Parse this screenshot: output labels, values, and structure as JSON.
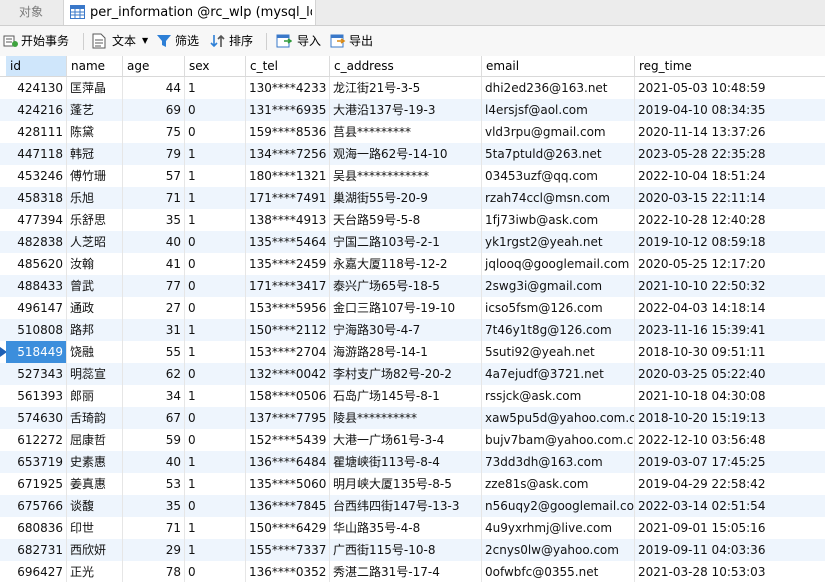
{
  "tabs": {
    "objects": "对象",
    "active": "per_information @rc_wlp (mysql_loc..."
  },
  "toolbar": {
    "begin_tx": "开始事务",
    "text": "文本",
    "filter": "筛选",
    "sort": "排序",
    "import": "导入",
    "export": "导出"
  },
  "columns": [
    "id",
    "name",
    "age",
    "sex",
    "c_tel",
    "c_address",
    "email",
    "reg_time"
  ],
  "rows": [
    [
      "424130",
      "匡萍晶",
      "44",
      "1",
      "130****4233",
      "龙江街21号-3-5",
      "dhi2ed236@163.net",
      "2021-05-03 10:48:59"
    ],
    [
      "424216",
      "蓬艺",
      "69",
      "0",
      "131****6935",
      "大港沿137号-19-3",
      "l4ersjsf@aol.com",
      "2019-04-10 08:34:35"
    ],
    [
      "428111",
      "陈黛",
      "75",
      "0",
      "159****8536",
      "莒县*********",
      "vld3rpu@gmail.com",
      "2020-11-14 13:37:26"
    ],
    [
      "447118",
      "韩冠",
      "79",
      "1",
      "134****7256",
      "观海一路62号-14-10",
      "5ta7ptuld@263.net",
      "2023-05-28 22:35:28"
    ],
    [
      "453246",
      "傅竹珊",
      "57",
      "1",
      "180****1321",
      "吴县************",
      "03453uzf@qq.com",
      "2022-10-04 18:51:24"
    ],
    [
      "458318",
      "乐旭",
      "71",
      "1",
      "171****7491",
      "巢湖街55号-20-9",
      "rzah74ccl@msn.com",
      "2020-03-15 22:11:14"
    ],
    [
      "477394",
      "乐舒思",
      "35",
      "1",
      "138****4913",
      "天台路59号-5-8",
      "1fj73iwb@ask.com",
      "2022-10-28 12:40:28"
    ],
    [
      "482838",
      "人芝昭",
      "40",
      "0",
      "135****5464",
      "宁国二路103号-2-1",
      "yk1rgst2@yeah.net",
      "2019-10-12 08:59:18"
    ],
    [
      "485620",
      "汝翰",
      "41",
      "0",
      "135****2459",
      "永嘉大厦118号-12-2",
      "jqlooq@googlemail.com",
      "2020-05-25 12:17:20"
    ],
    [
      "488433",
      "曾武",
      "77",
      "0",
      "171****3417",
      "泰兴广场65号-18-5",
      "2swg3i@gmail.com",
      "2021-10-10 22:50:32"
    ],
    [
      "496147",
      "通政",
      "27",
      "0",
      "153****5956",
      "金口三路107号-19-10",
      "icso5fsm@126.com",
      "2022-04-03 14:18:14"
    ],
    [
      "510808",
      "路邦",
      "31",
      "1",
      "150****2112",
      "宁海路30号-4-7",
      "7t46y1t8g@126.com",
      "2023-11-16 15:39:41"
    ],
    [
      "518449",
      "饶融",
      "55",
      "1",
      "153****2704",
      "海游路28号-14-1",
      "5suti92@yeah.net",
      "2018-10-30 09:51:11"
    ],
    [
      "527343",
      "明蕊宣",
      "62",
      "0",
      "132****0042",
      "李村支广场82号-20-2",
      "4a7ejudf@3721.net",
      "2020-03-25 05:22:40"
    ],
    [
      "561393",
      "郎丽",
      "34",
      "1",
      "158****0506",
      "石岛广场145号-8-1",
      "rssjck@ask.com",
      "2021-10-18 04:30:08"
    ],
    [
      "574630",
      "舌琦韵",
      "67",
      "0",
      "137****7795",
      "陵县**********",
      "xaw5pu5d@yahoo.com.cn",
      "2018-10-20 15:19:13"
    ],
    [
      "612272",
      "屈康哲",
      "59",
      "0",
      "152****5439",
      "大港一广场61号-3-4",
      "bujv7bam@yahoo.com.cn",
      "2022-12-10 03:56:48"
    ],
    [
      "653719",
      "史素惠",
      "40",
      "1",
      "136****6484",
      "瞿塘峡街113号-8-4",
      "73dd3dh@163.com",
      "2019-03-07 17:45:25"
    ],
    [
      "671925",
      "姜真惠",
      "53",
      "1",
      "135****5060",
      "明月峡大厦135号-8-5",
      "zze81s@ask.com",
      "2019-04-29 22:58:42"
    ],
    [
      "675766",
      "谈馥",
      "35",
      "0",
      "136****7845",
      "台西纬四街147号-13-3",
      "n56uqy2@googlemail.com",
      "2022-03-14 02:51:54"
    ],
    [
      "680836",
      "印世",
      "71",
      "1",
      "150****6429",
      "华山路35号-4-8",
      "4u9yxrhmj@live.com",
      "2021-09-01 15:05:16"
    ],
    [
      "682731",
      "西欣妍",
      "29",
      "1",
      "155****7337",
      "广西街115号-10-8",
      "2cnys0lw@yahoo.com",
      "2019-09-11 04:03:36"
    ],
    [
      "696427",
      "正光",
      "78",
      "0",
      "136****0352",
      "秀湛二路31号-17-4",
      "0ofwbfc@0355.net",
      "2021-03-28 10:53:03"
    ]
  ],
  "current_row": 12
}
